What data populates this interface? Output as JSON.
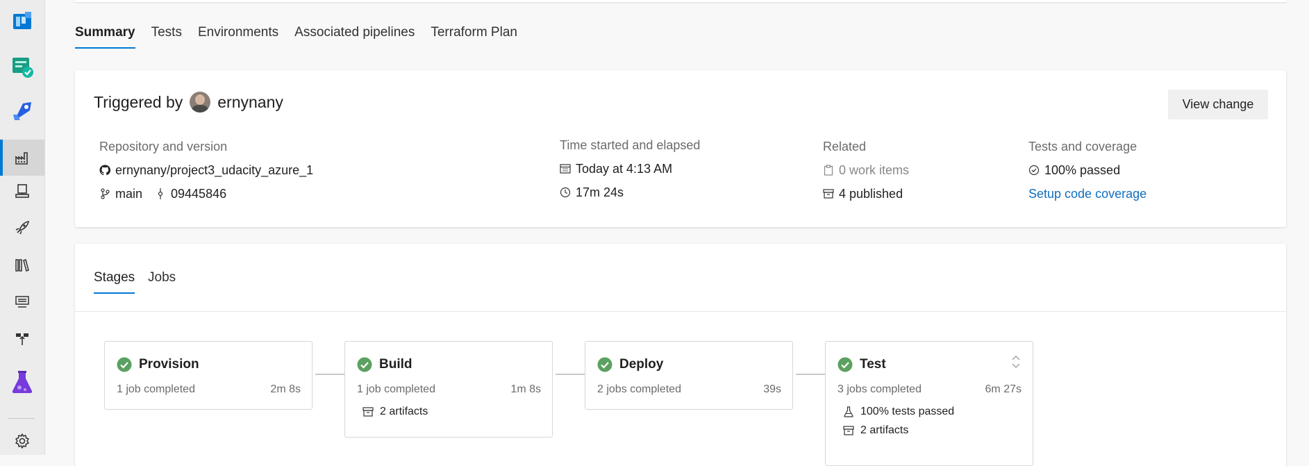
{
  "rail": {
    "items": [
      {
        "name": "boards-icon",
        "color": "#0078d4"
      },
      {
        "name": "test-plans-board-icon",
        "color": "#009ccc"
      },
      {
        "name": "pipelines-icon",
        "color": "#2560e0"
      },
      {
        "name": "pipelines-runs-icon",
        "color": "#333333"
      },
      {
        "name": "environments-icon",
        "color": "#333333"
      },
      {
        "name": "releases-icon",
        "color": "#333333"
      },
      {
        "name": "library-icon",
        "color": "#333333"
      },
      {
        "name": "task-groups-icon",
        "color": "#333333"
      },
      {
        "name": "deployment-groups-icon",
        "color": "#333333"
      },
      {
        "name": "test-plans-icon",
        "color": "#773adc"
      },
      {
        "name": "settings-icon",
        "color": "#333333"
      }
    ]
  },
  "tabs": [
    "Summary",
    "Tests",
    "Environments",
    "Associated pipelines",
    "Terraform Plan"
  ],
  "summary": {
    "triggered_prefix": "Triggered by",
    "user": "ernynany",
    "view_change": "View change",
    "repo_label": "Repository and version",
    "repo": "ernynany/project3_udacity_azure_1",
    "branch": "main",
    "commit": "09445846",
    "time_label": "Time started and elapsed",
    "started": "Today at 4:13 AM",
    "elapsed": "17m 24s",
    "related_label": "Related",
    "work_items": "0 work items",
    "published": "4 published",
    "tests_label": "Tests and coverage",
    "tests_passed": "100% passed",
    "coverage_link": "Setup code coverage"
  },
  "stage_tabs": [
    "Stages",
    "Jobs"
  ],
  "stages": [
    {
      "name": "Provision",
      "jobs": "1 job completed",
      "duration": "2m 8s",
      "extras": []
    },
    {
      "name": "Build",
      "jobs": "1 job completed",
      "duration": "1m 8s",
      "extras": [
        {
          "icon": "artifact-icon",
          "text": "2 artifacts"
        }
      ]
    },
    {
      "name": "Deploy",
      "jobs": "2 jobs completed",
      "duration": "39s",
      "extras": []
    },
    {
      "name": "Test",
      "jobs": "3 jobs completed",
      "duration": "6m 27s",
      "extras": [
        {
          "icon": "flask-icon",
          "text": "100% tests passed"
        },
        {
          "icon": "artifact-icon",
          "text": "2 artifacts"
        }
      ]
    }
  ],
  "colors": {
    "accent": "#0078d4",
    "success": "#107c10",
    "success_fill": "#5ba160",
    "link": "#106ebe"
  }
}
